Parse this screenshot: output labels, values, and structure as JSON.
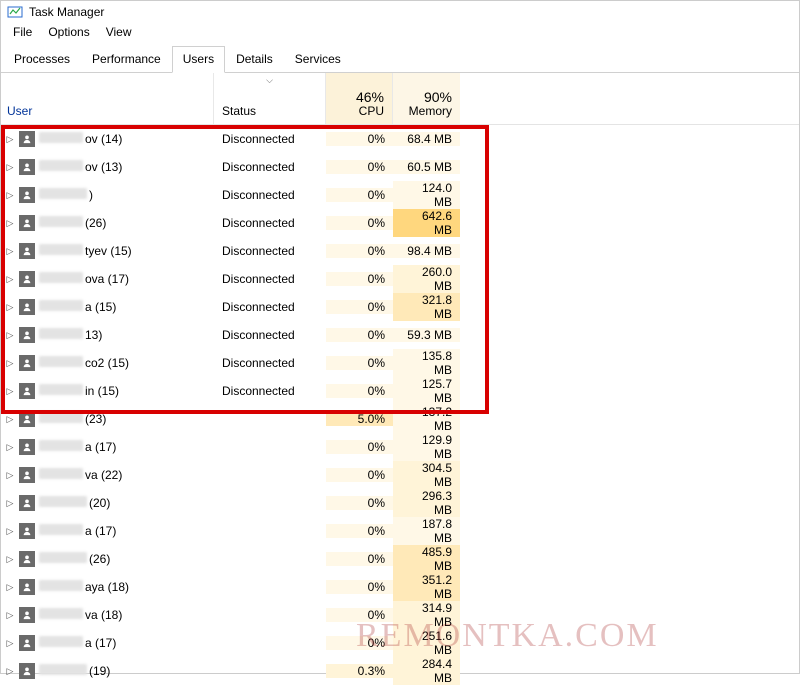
{
  "window": {
    "title": "Task Manager"
  },
  "menu": {
    "file": "File",
    "options": "Options",
    "view": "View"
  },
  "tabs": {
    "processes": "Processes",
    "performance": "Performance",
    "users": "Users",
    "details": "Details",
    "services": "Services"
  },
  "columns": {
    "user": "User",
    "status": "Status",
    "cpu_pct": "46%",
    "cpu": "CPU",
    "mem_pct": "90%",
    "mem": "Memory"
  },
  "rows": [
    {
      "suffix": "ov (14)",
      "status": "Disconnected",
      "cpu": "0%",
      "mem": "68.4 MB",
      "cpu_heat": "heat-low",
      "mem_heat": "heat-low",
      "blur_w": 44
    },
    {
      "suffix": "ov (13)",
      "status": "Disconnected",
      "cpu": "0%",
      "mem": "60.5 MB",
      "cpu_heat": "heat-low",
      "mem_heat": "heat-low",
      "blur_w": 44
    },
    {
      "suffix": ")",
      "status": "Disconnected",
      "cpu": "0%",
      "mem": "124.0 MB",
      "cpu_heat": "heat-low",
      "mem_heat": "heat-low",
      "blur_w": 48
    },
    {
      "suffix": " (26)",
      "status": "Disconnected",
      "cpu": "0%",
      "mem": "642.6 MB",
      "cpu_heat": "heat-low",
      "mem_heat": "heat-high",
      "blur_w": 44
    },
    {
      "suffix": "tyev (15)",
      "status": "Disconnected",
      "cpu": "0%",
      "mem": "98.4 MB",
      "cpu_heat": "heat-low",
      "mem_heat": "heat-low",
      "blur_w": 44
    },
    {
      "suffix": "ova (17)",
      "status": "Disconnected",
      "cpu": "0%",
      "mem": "260.0 MB",
      "cpu_heat": "heat-low",
      "mem_heat": "heat-lowmid",
      "blur_w": 44
    },
    {
      "suffix": "a (15)",
      "status": "Disconnected",
      "cpu": "0%",
      "mem": "321.8 MB",
      "cpu_heat": "heat-low",
      "mem_heat": "heat-mid",
      "blur_w": 44
    },
    {
      "suffix": "13)",
      "status": "Disconnected",
      "cpu": "0%",
      "mem": "59.3 MB",
      "cpu_heat": "heat-low",
      "mem_heat": "heat-low",
      "blur_w": 44
    },
    {
      "suffix": "co2 (15)",
      "status": "Disconnected",
      "cpu": "0%",
      "mem": "135.8 MB",
      "cpu_heat": "heat-low",
      "mem_heat": "heat-low",
      "blur_w": 44
    },
    {
      "suffix": "in (15)",
      "status": "Disconnected",
      "cpu": "0%",
      "mem": "125.7 MB",
      "cpu_heat": "heat-low",
      "mem_heat": "heat-low",
      "blur_w": 44
    },
    {
      "suffix": " (23)",
      "status": "",
      "cpu": "5.0%",
      "mem": "137.2 MB",
      "cpu_heat": "heat-mid",
      "mem_heat": "heat-low",
      "blur_w": 44
    },
    {
      "suffix": "a (17)",
      "status": "",
      "cpu": "0%",
      "mem": "129.9 MB",
      "cpu_heat": "heat-low",
      "mem_heat": "heat-low",
      "blur_w": 44
    },
    {
      "suffix": "va (22)",
      "status": "",
      "cpu": "0%",
      "mem": "304.5 MB",
      "cpu_heat": "heat-low",
      "mem_heat": "heat-lowmid",
      "blur_w": 44
    },
    {
      "suffix": "(20)",
      "status": "",
      "cpu": "0%",
      "mem": "296.3 MB",
      "cpu_heat": "heat-low",
      "mem_heat": "heat-lowmid",
      "blur_w": 48
    },
    {
      "suffix": "a (17)",
      "status": "",
      "cpu": "0%",
      "mem": "187.8 MB",
      "cpu_heat": "heat-low",
      "mem_heat": "heat-low",
      "blur_w": 44
    },
    {
      "suffix": " (26)",
      "status": "",
      "cpu": "0%",
      "mem": "485.9 MB",
      "cpu_heat": "heat-low",
      "mem_heat": "heat-mid",
      "blur_w": 48
    },
    {
      "suffix": "aya (18)",
      "status": "",
      "cpu": "0%",
      "mem": "351.2 MB",
      "cpu_heat": "heat-low",
      "mem_heat": "heat-mid",
      "blur_w": 44
    },
    {
      "suffix": "va (18)",
      "status": "",
      "cpu": "0%",
      "mem": "314.9 MB",
      "cpu_heat": "heat-low",
      "mem_heat": "heat-lowmid",
      "blur_w": 44
    },
    {
      "suffix": "a (17)",
      "status": "",
      "cpu": "0%",
      "mem": "251.6 MB",
      "cpu_heat": "heat-low",
      "mem_heat": "heat-lowmid",
      "blur_w": 44
    },
    {
      "suffix": " (19)",
      "status": "",
      "cpu": "0.3%",
      "mem": "284.4 MB",
      "cpu_heat": "heat-lowmid",
      "mem_heat": "heat-lowmid",
      "blur_w": 48
    }
  ],
  "watermark": "REMONTKA.COM"
}
